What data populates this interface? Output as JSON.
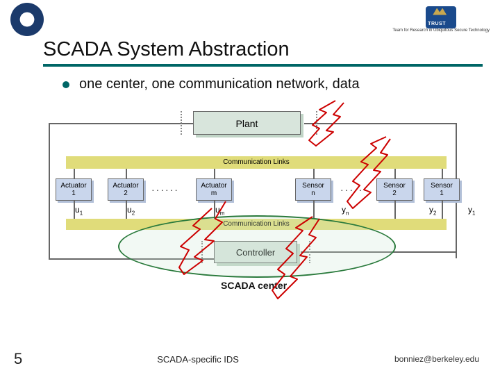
{
  "header": {
    "logo_left_name": "uc-berkeley-seal",
    "logo_right_name": "trust-logo",
    "logo_right_caption": "Team for Research in Ubiquitous Secure Technology"
  },
  "title": "SCADA System Abstraction",
  "bullet": "one center, one communication network, data",
  "diagram": {
    "plant": "Plant",
    "controller": "Controller",
    "comm_links_top": "Communication Links",
    "comm_links_bot": "Communication Links",
    "actuators": [
      {
        "label_top": "Actuator",
        "label_bot": "1",
        "var": "u",
        "sub": "1"
      },
      {
        "label_top": "Actuator",
        "label_bot": "2",
        "var": "u",
        "sub": "2"
      },
      {
        "label_top": "Actuator",
        "label_bot": "m",
        "var": "u",
        "sub": "m"
      }
    ],
    "sensors": [
      {
        "label_top": "Sensor",
        "label_bot": "n",
        "var": "y",
        "sub": "n"
      },
      {
        "label_top": "Sensor",
        "label_bot": "2",
        "var": "y",
        "sub": "2"
      },
      {
        "label_top": "Sensor",
        "label_bot": "1",
        "var": "y",
        "sub": "1"
      }
    ],
    "dots": "······",
    "scada_center": "SCADA center"
  },
  "footer": {
    "page": "5",
    "center": "SCADA-specific IDS",
    "right": "bonniez@berkeley.edu"
  },
  "colors": {
    "accent": "#006666",
    "band": "#e0dc7a",
    "node": "#c9d6ec",
    "plant_bg": "#d8e5dc",
    "scribble": "#cc0000"
  }
}
